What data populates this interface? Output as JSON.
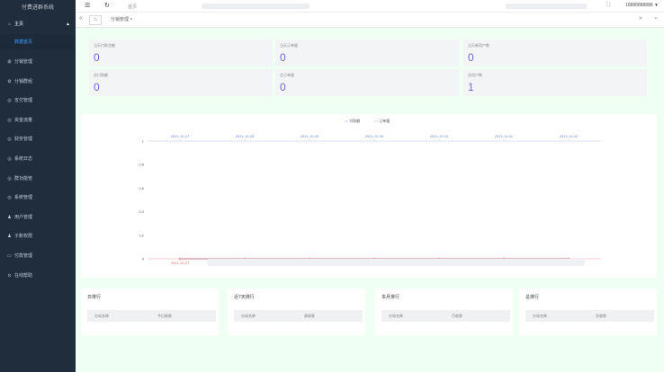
{
  "sidebar": {
    "brand": "付费进群系统",
    "home": "主页",
    "home_caret": "▲",
    "active_sub": "数据首页",
    "items": [
      {
        "icon": "⊞",
        "label": "分销管理"
      },
      {
        "icon": "⚙",
        "label": "分销群组"
      },
      {
        "icon": "◎",
        "label": "支付管理"
      },
      {
        "icon": "◎",
        "label": "资金流量"
      },
      {
        "icon": "◎",
        "label": "财务管理"
      },
      {
        "icon": "◎",
        "label": "系统日志"
      },
      {
        "icon": "◎",
        "label": "群功能管"
      },
      {
        "icon": "◎",
        "label": "系统管理"
      },
      {
        "icon": "♟",
        "label": "用户管理"
      },
      {
        "icon": "♟",
        "label": "子账权限"
      },
      {
        "icon": "▭",
        "label": "付款管理"
      },
      {
        "icon": "⊙",
        "label": "在线帮助"
      }
    ]
  },
  "topbar": {
    "menu_icon": "☰",
    "refresh_icon": "↻",
    "crumb": "首页",
    "fullscreen_icon": "⛶",
    "user": "18888888888 ▼"
  },
  "tags": {
    "left_icon": "«",
    "home_icon": "⌂",
    "current": "分销管理 ×",
    "right_icon": "»",
    "down_icon": "⌄"
  },
  "stats": [
    {
      "label": "当天付款总额",
      "value": "0"
    },
    {
      "label": "当天订单量",
      "value": "0"
    },
    {
      "label": "当天新用户数",
      "value": "0"
    },
    {
      "label": "总付款额",
      "value": "0"
    },
    {
      "label": "总订单量",
      "value": "0"
    },
    {
      "label": "总用户数",
      "value": "1"
    }
  ],
  "chart_data": {
    "type": "line",
    "x": [
      "2021-10-27",
      "2021-10-28",
      "2021-10-29",
      "2021-10-30",
      "2021-10-31",
      "2021-11-01",
      "2021-11-02"
    ],
    "series": [
      {
        "name": "付款额",
        "values": [
          0,
          0,
          0,
          0,
          0,
          0,
          0
        ],
        "color": "#5470c6"
      },
      {
        "name": "订单量",
        "values": [
          0,
          0,
          0,
          0,
          0,
          0,
          0
        ],
        "color": "#e06c6c"
      }
    ],
    "ylim": [
      0,
      1
    ],
    "yticks": [
      "1",
      "0.8",
      "0.6",
      "0.4",
      "0.2",
      "0"
    ],
    "bottom_ticks": [
      "2021-10-27",
      "",
      "2021-10-29",
      "2021-10-30",
      "2021-10-31",
      "2021-11-",
      ""
    ],
    "grid": false,
    "legend": "top-center"
  },
  "rankings": [
    {
      "title": "日排行",
      "col1": "分站名称",
      "col2": "今日收款"
    },
    {
      "title": "近7天排行",
      "col1": "分站名称",
      "col2": "周收款"
    },
    {
      "title": "本月排行",
      "col1": "分站名称",
      "col2": "月收款"
    },
    {
      "title": "总排行",
      "col1": "分站名称",
      "col2": "总收款"
    }
  ]
}
